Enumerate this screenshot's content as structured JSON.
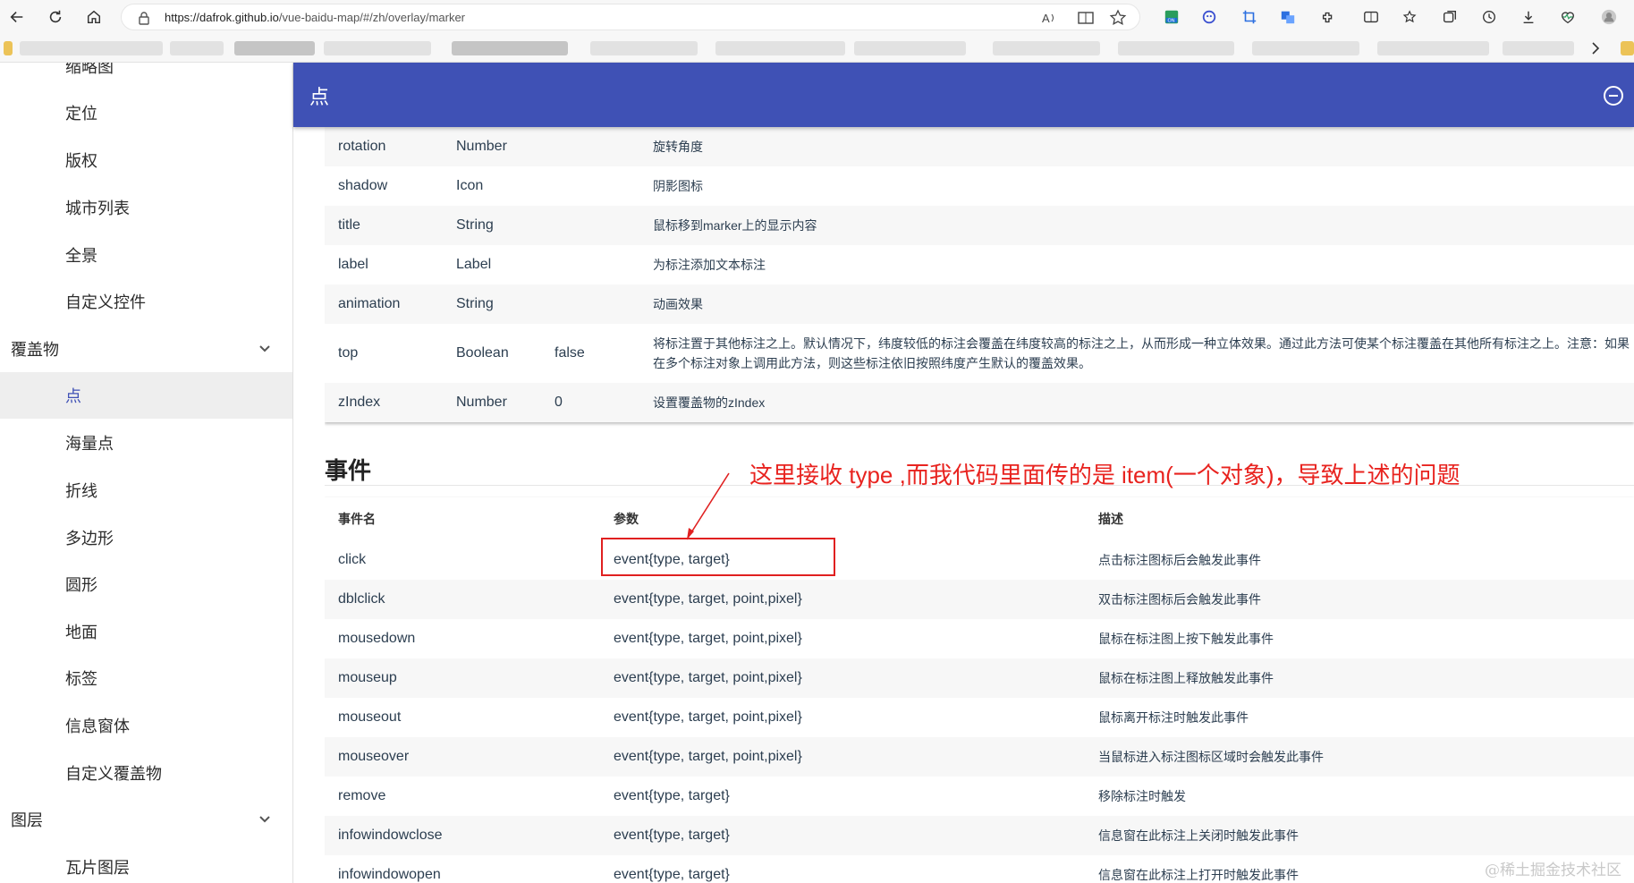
{
  "browser": {
    "url_host": "https://dafrok.github.io",
    "url_path": "/vue-baidu-map/#/zh/overlay/marker",
    "icons": [
      "back-icon",
      "refresh-icon",
      "home-icon",
      "lock-icon",
      "read-aloud-icon",
      "immersive-reader-icon",
      "favorite-star-icon",
      "extension-icons",
      "split-screen-icon",
      "favorites-icon",
      "collections-icon",
      "history-icon",
      "downloads-icon",
      "performance-icon",
      "profile-icon"
    ]
  },
  "sidebar": {
    "items": [
      {
        "label": "缩略图",
        "type": "child"
      },
      {
        "label": "定位",
        "type": "child"
      },
      {
        "label": "版权",
        "type": "child"
      },
      {
        "label": "城市列表",
        "type": "child"
      },
      {
        "label": "全景",
        "type": "child"
      },
      {
        "label": "自定义控件",
        "type": "child"
      },
      {
        "label": "覆盖物",
        "type": "group"
      },
      {
        "label": "点",
        "type": "active"
      },
      {
        "label": "海量点",
        "type": "child"
      },
      {
        "label": "折线",
        "type": "child"
      },
      {
        "label": "多边形",
        "type": "child"
      },
      {
        "label": "圆形",
        "type": "child"
      },
      {
        "label": "地面",
        "type": "child"
      },
      {
        "label": "标签",
        "type": "child"
      },
      {
        "label": "信息窗体",
        "type": "child"
      },
      {
        "label": "自定义覆盖物",
        "type": "child"
      },
      {
        "label": "图层",
        "type": "group"
      },
      {
        "label": "瓦片图层",
        "type": "child"
      }
    ]
  },
  "header": {
    "title": "点"
  },
  "props": [
    {
      "name": "rotation",
      "type": "Number",
      "default": "",
      "desc": "旋转角度"
    },
    {
      "name": "shadow",
      "type": "Icon",
      "default": "",
      "desc": "阴影图标"
    },
    {
      "name": "title",
      "type": "String",
      "default": "",
      "desc": "鼠标移到marker上的显示内容"
    },
    {
      "name": "label",
      "type": "Label",
      "default": "",
      "desc": "为标注添加文本标注"
    },
    {
      "name": "animation",
      "type": "String",
      "default": "",
      "desc": "动画效果"
    },
    {
      "name": "top",
      "type": "Boolean",
      "default": "false",
      "desc": "将标注置于其他标注之上。默认情况下，纬度较低的标注会覆盖在纬度较高的标注之上，从而形成一种立体效果。通过此方法可使某个标注覆盖在其他所有标注之上。注意：如果在多个标注对象上调用此方法，则这些标注依旧按照纬度产生默认的覆盖效果。"
    },
    {
      "name": "zIndex",
      "type": "Number",
      "default": "0",
      "desc": "设置覆盖物的zIndex"
    }
  ],
  "events_section": {
    "title": "事件",
    "headers": {
      "name": "事件名",
      "params": "参数",
      "desc": "描述"
    },
    "rows": [
      {
        "name": "click",
        "params": "event{type, target}",
        "desc": "点击标注图标后会触发此事件"
      },
      {
        "name": "dblclick",
        "params": "event{type, target, point,pixel}",
        "desc": "双击标注图标后会触发此事件"
      },
      {
        "name": "mousedown",
        "params": "event{type, target, point,pixel}",
        "desc": "鼠标在标注图上按下触发此事件"
      },
      {
        "name": "mouseup",
        "params": "event{type, target, point,pixel}",
        "desc": "鼠标在标注图上释放触发此事件"
      },
      {
        "name": "mouseout",
        "params": "event{type, target, point,pixel}",
        "desc": "鼠标离开标注时触发此事件"
      },
      {
        "name": "mouseover",
        "params": "event{type, target, point,pixel}",
        "desc": "当鼠标进入标注图标区域时会触发此事件"
      },
      {
        "name": "remove",
        "params": "event{type, target}",
        "desc": "移除标注时触发"
      },
      {
        "name": "infowindowclose",
        "params": "event{type, target}",
        "desc": "信息窗在此标注上关闭时触发此事件"
      },
      {
        "name": "infowindowopen",
        "params": "event{type, target}",
        "desc": "信息窗在此标注上打开时触发此事件"
      }
    ]
  },
  "annotation": {
    "text": "这里接收 type ,而我代码里面传的是 item(一个对象)，导致上述的问题",
    "color": "#e8231f"
  },
  "watermark": "@稀土掘金技术社区",
  "colors": {
    "appbar": "#3f51b5",
    "active_text": "#3f51b5",
    "annotation_red": "#e02020"
  }
}
